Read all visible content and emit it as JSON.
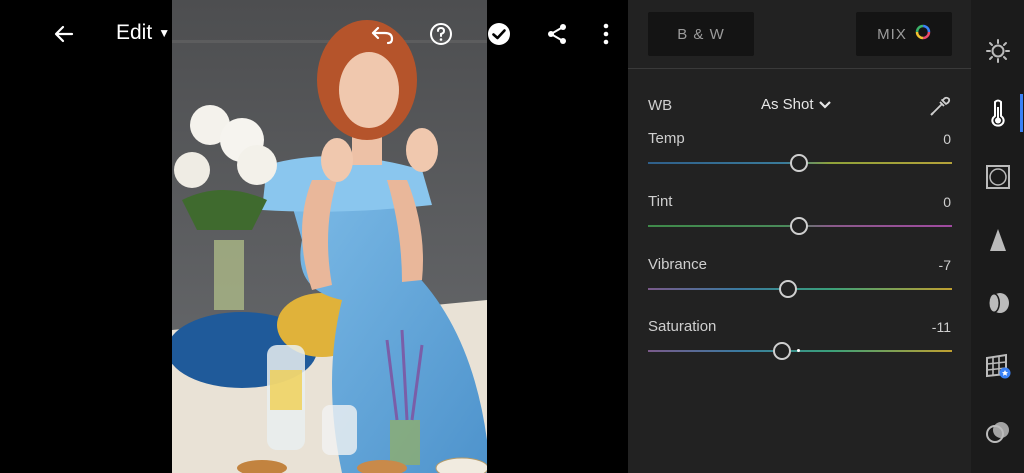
{
  "header": {
    "edit_label": "Edit",
    "icons": [
      "back-arrow-icon",
      "undo-icon",
      "help-icon",
      "checkmark-icon",
      "share-icon",
      "more-vertical-icon"
    ]
  },
  "panel": {
    "tabs": {
      "bw_label": "B & W",
      "mix_label": "MIX"
    },
    "wb": {
      "label": "WB",
      "value": "As Shot"
    },
    "sliders": [
      {
        "label": "Temp",
        "value": "0",
        "level": 0.5
      },
      {
        "label": "Tint",
        "value": "0",
        "level": 0.5
      },
      {
        "label": "Vibrance",
        "value": "-7",
        "level": 0.465
      },
      {
        "label": "Saturation",
        "value": "-11",
        "level": 0.445
      }
    ]
  },
  "toolbar": {
    "tools": [
      "light-icon",
      "color-thermometer-icon",
      "effects-frame-icon",
      "detail-triangle-icon",
      "optics-lens-icon",
      "geometry-grid-icon",
      "presets-circles-icon"
    ],
    "active": "color-thermometer-icon"
  },
  "colors": {
    "accent": "#3b82f6",
    "panel_bg": "#222222",
    "toolbar_bg": "#1b1b1b"
  }
}
